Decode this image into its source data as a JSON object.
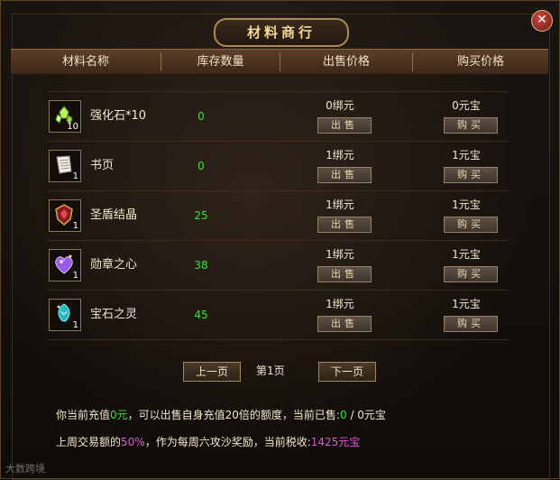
{
  "window": {
    "title": "材料商行",
    "close_label": "✕"
  },
  "columns": [
    "材料名称",
    "库存数量",
    "出售价格",
    "购买价格"
  ],
  "items": [
    {
      "name": "强化石*10",
      "qty": "10",
      "stock": "0",
      "sell_price": "0绑元",
      "buy_price": "0元宝",
      "sell_label": "出售",
      "buy_label": "购买",
      "icon": "crystal-shard-icon"
    },
    {
      "name": "书页",
      "qty": "1",
      "stock": "0",
      "sell_price": "1绑元",
      "buy_price": "1元宝",
      "sell_label": "出售",
      "buy_label": "购买",
      "icon": "book-page-icon"
    },
    {
      "name": "圣盾结晶",
      "qty": "1",
      "stock": "25",
      "sell_price": "1绑元",
      "buy_price": "1元宝",
      "sell_label": "出售",
      "buy_label": "购买",
      "icon": "shield-crystal-icon"
    },
    {
      "name": "勋章之心",
      "qty": "1",
      "stock": "38",
      "sell_price": "1绑元",
      "buy_price": "1元宝",
      "sell_label": "出售",
      "buy_label": "购买",
      "icon": "heart-gem-icon"
    },
    {
      "name": "宝石之灵",
      "qty": "1",
      "stock": "45",
      "sell_price": "1绑元",
      "buy_price": "1元宝",
      "sell_label": "出售",
      "buy_label": "购买",
      "icon": "gem-spirit-icon"
    }
  ],
  "pager": {
    "prev": "上一页",
    "current": "第1页",
    "next": "下一页"
  },
  "info1": {
    "p1": "你当前充值",
    "recharge": "0元",
    "p2": "，可以出售自身充值20倍的额度，当前已售:",
    "sold": "0",
    "p3": " / 0元宝"
  },
  "info2": {
    "p1": "上周交易额的",
    "percent": "50%",
    "p2": "，作为每周六攻沙奖励，当前税收:",
    "tax": "1425元宝"
  },
  "watermark": "大数跨境",
  "colors": {
    "green": "#3ee03e",
    "magenta": "#e05ad8",
    "gold": "#f3d79a"
  }
}
